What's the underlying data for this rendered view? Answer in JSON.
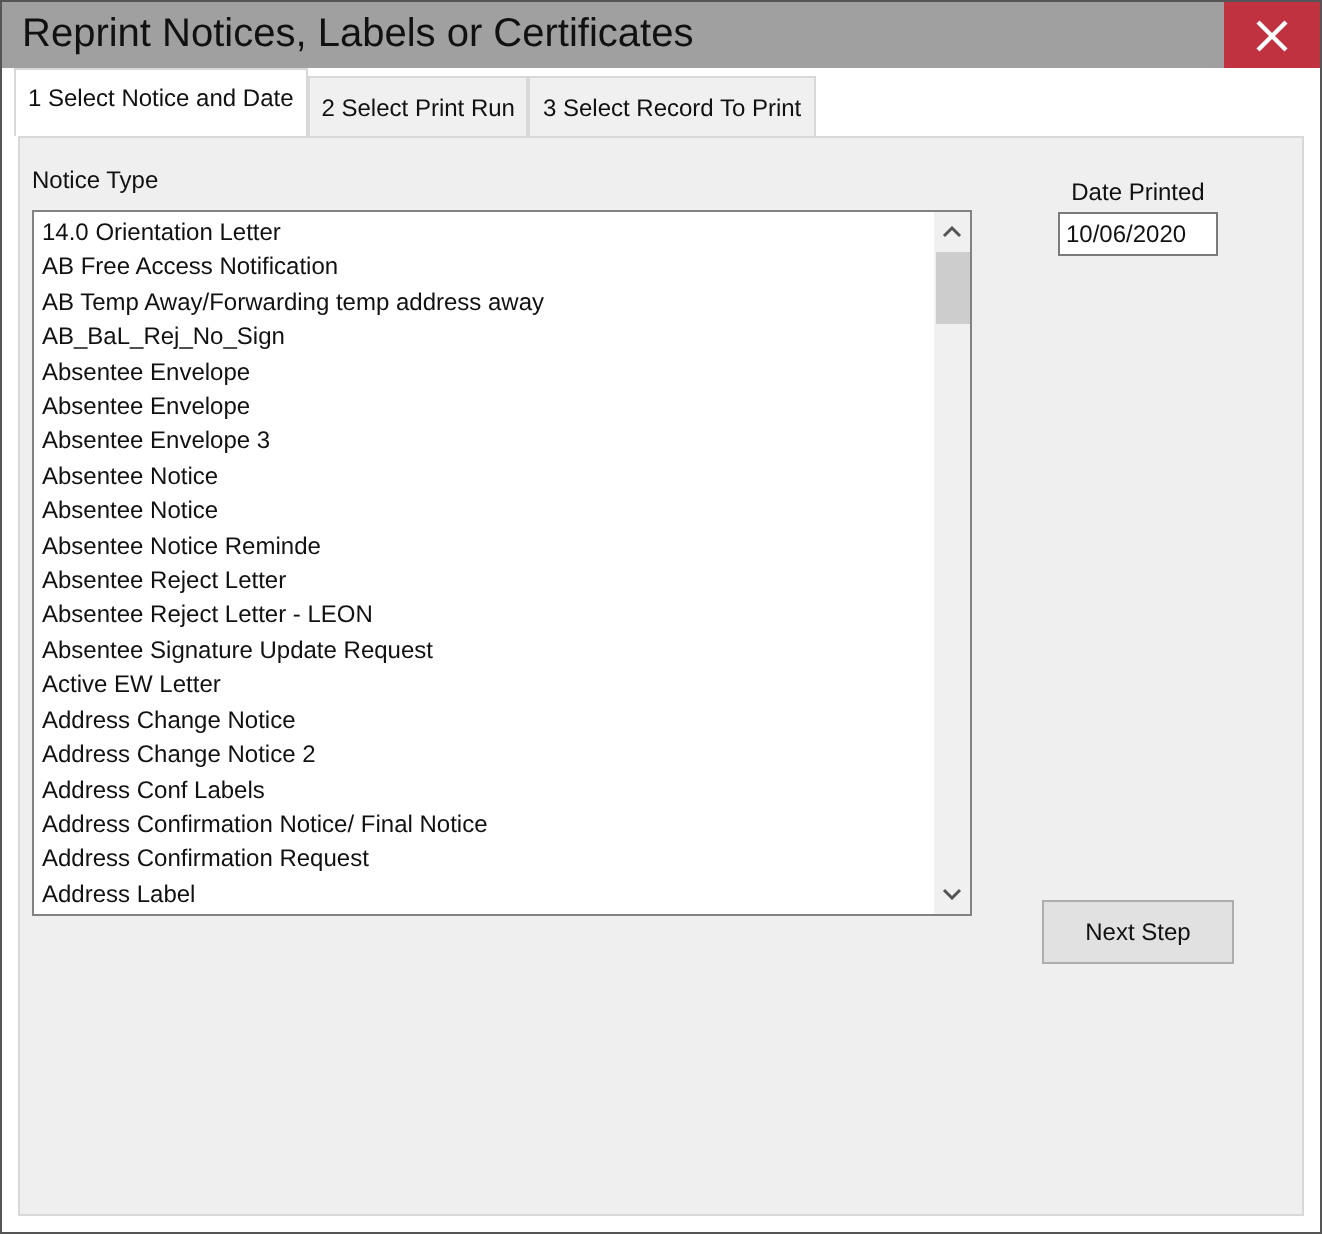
{
  "window": {
    "title": "Reprint Notices, Labels or Certificates"
  },
  "tabs": [
    {
      "label": "1  Select Notice and Date",
      "selected": true
    },
    {
      "label": "2  Select Print Run",
      "selected": false
    },
    {
      "label": "3  Select Record To Print",
      "selected": false
    }
  ],
  "notice_type": {
    "label": "Notice Type",
    "items": [
      "14.0 Orientation Letter",
      "AB Free Access Notification",
      "AB Temp Away/Forwarding temp address away",
      "AB_BaL_Rej_No_Sign",
      "Absentee Envelope",
      "Absentee Envelope",
      "Absentee Envelope 3",
      "Absentee Notice",
      "Absentee Notice",
      "Absentee Notice Reminde",
      "Absentee Reject Letter",
      "Absentee Reject Letter - LEON",
      "Absentee Signature Update Request",
      "Active EW Letter",
      "Address Change Notice",
      "Address Change Notice 2",
      "Address Conf Labels",
      "Address Confirmation Notice/ Final Notice",
      "Address Confirmation Request",
      "Address Label"
    ]
  },
  "date_printed": {
    "label": "Date Printed",
    "value": "10/06/2020"
  },
  "buttons": [
    "Next Step"
  ]
}
